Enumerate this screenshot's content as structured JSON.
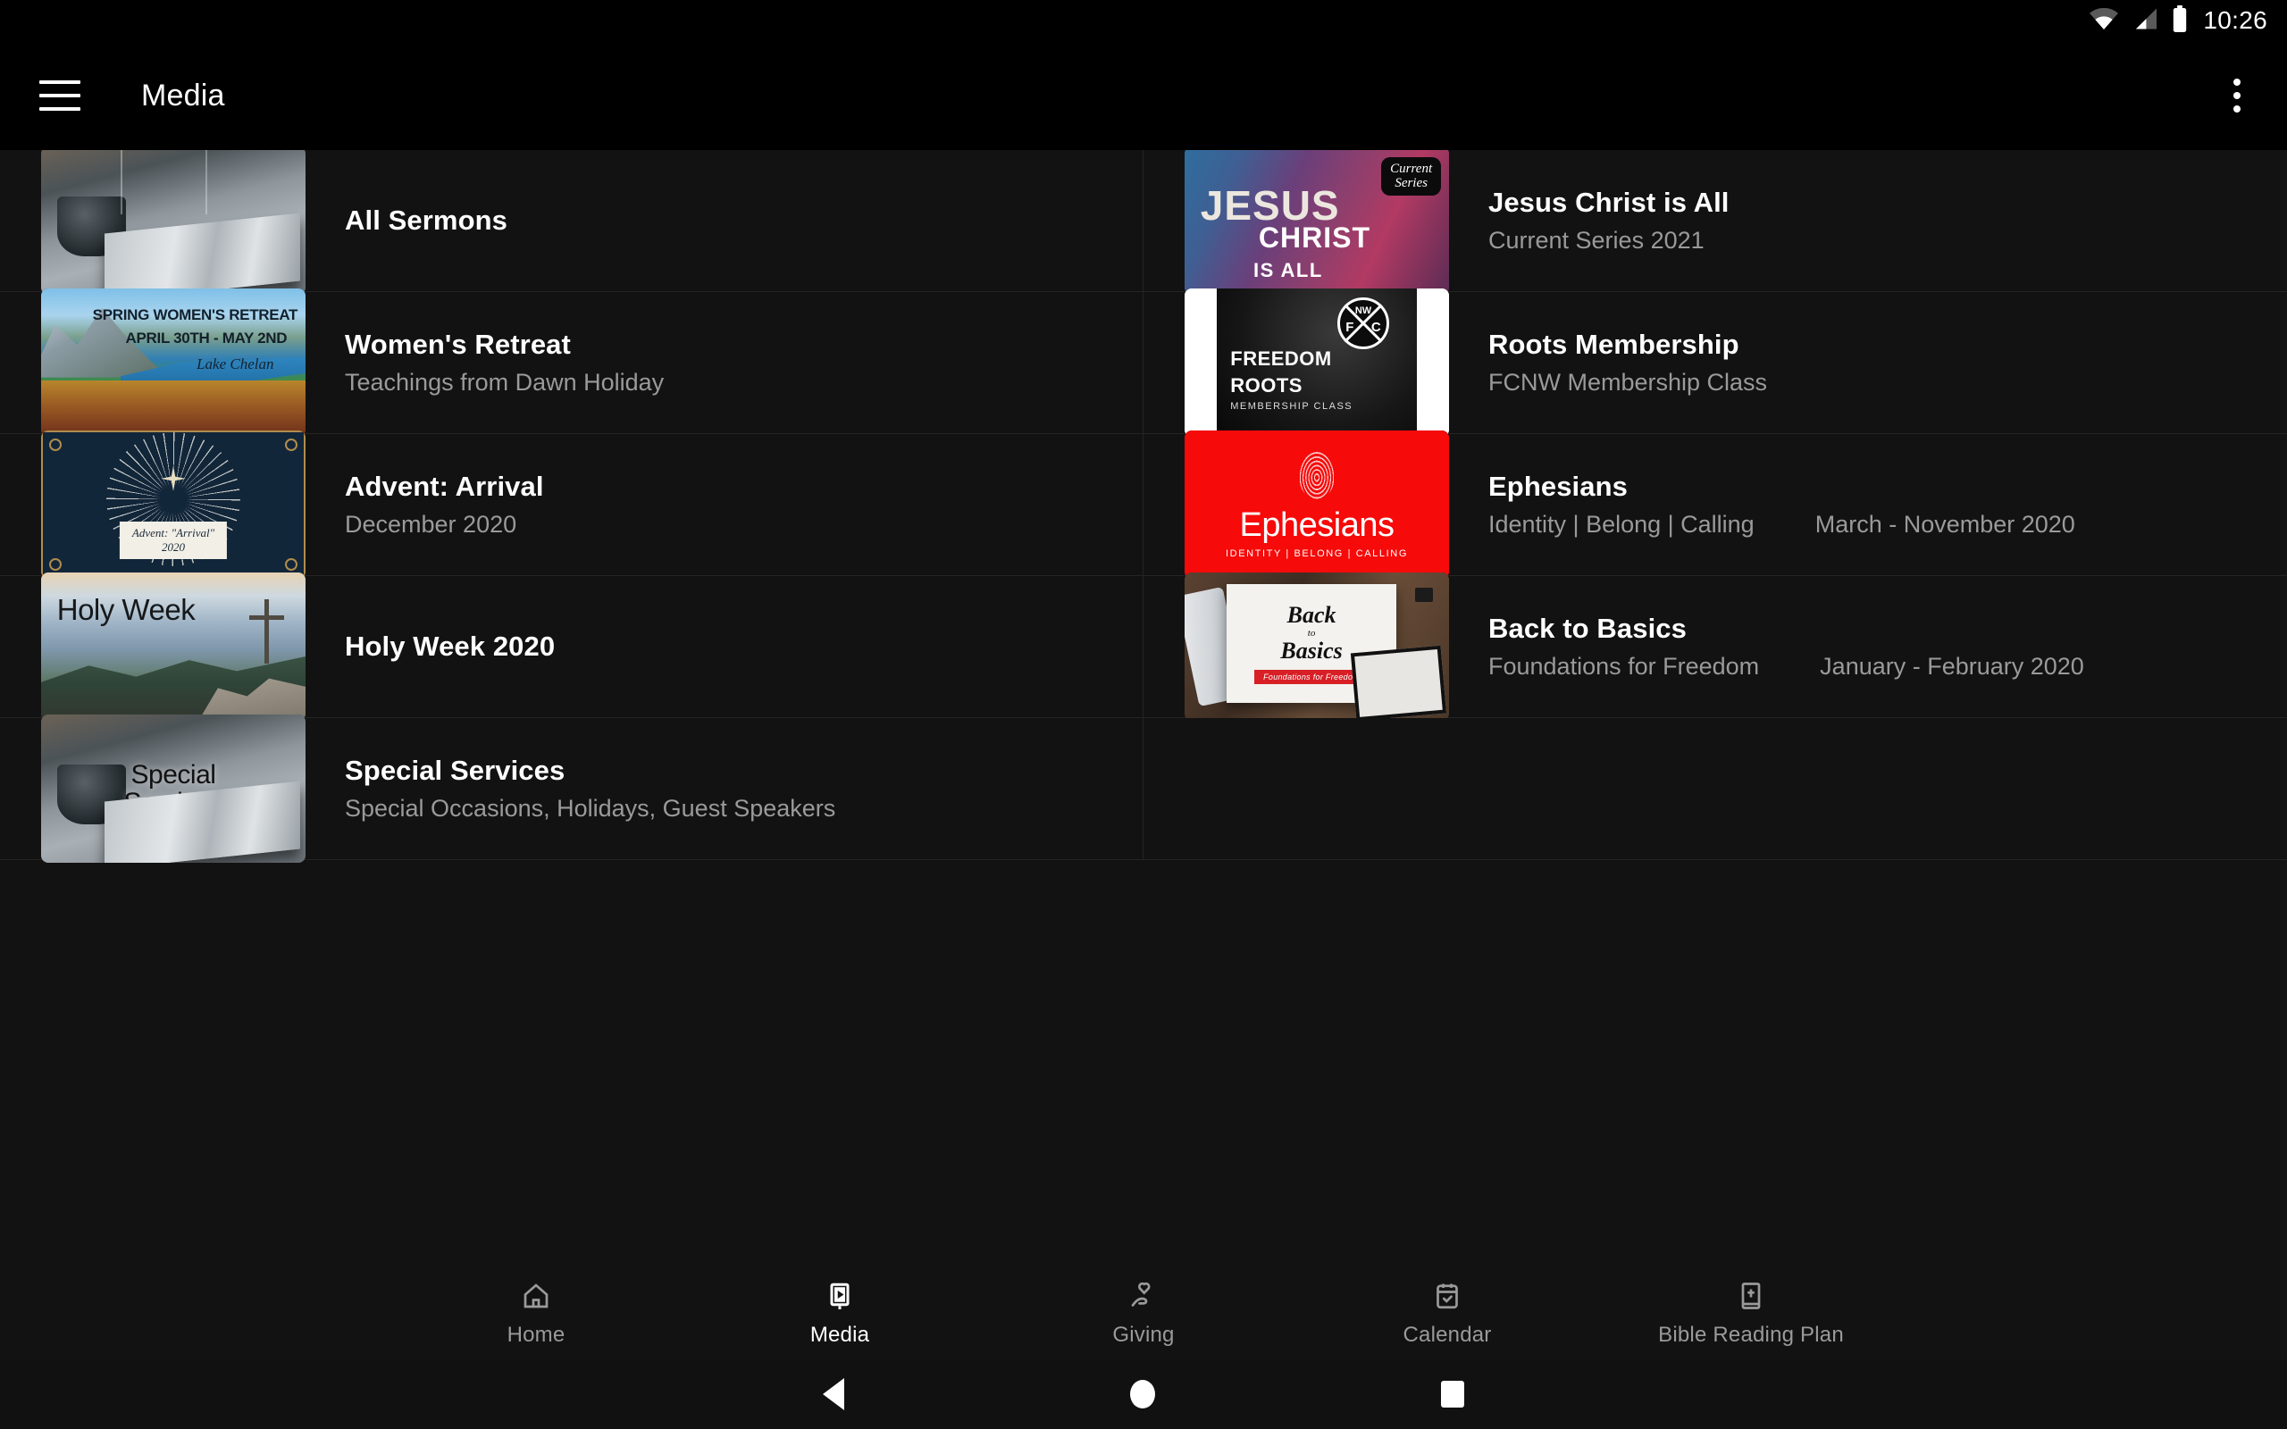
{
  "status_bar": {
    "time": "10:26",
    "icons": [
      "wifi-icon",
      "cellular-signal-icon",
      "battery-icon"
    ]
  },
  "app_bar": {
    "menu_icon": "hamburger-menu-icon",
    "title": "Media",
    "overflow_icon": "more-vertical-icon"
  },
  "media_items": [
    {
      "title": "All Sermons",
      "subtitle": "",
      "date": "",
      "thumb_kind": "bible",
      "thumb_text": {}
    },
    {
      "title": "Jesus Christ is All",
      "subtitle": "Current Series 2021",
      "date": "",
      "thumb_kind": "jesus",
      "thumb_text": {
        "line1": "JESUS",
        "line2": "CHRIST",
        "line3": "IS ALL",
        "badge1": "Current",
        "badge2": "Series"
      }
    },
    {
      "title": "Women's Retreat",
      "subtitle": "Teachings from Dawn Holiday",
      "date": "",
      "thumb_kind": "retreat",
      "thumb_text": {
        "line1": "SPRING WOMEN'S RETREAT",
        "line2": "APRIL 30TH - MAY 2ND",
        "line3": "Lake Chelan"
      }
    },
    {
      "title": "Roots Membership",
      "subtitle": "FCNW Membership Class",
      "date": "",
      "thumb_kind": "roots",
      "thumb_text": {
        "line1": "FREEDOM",
        "line2": "ROOTS",
        "line3": "MEMBERSHIP CLASS",
        "logo_nw": "NW",
        "logo_f": "F",
        "logo_c": "C"
      }
    },
    {
      "title": "Advent: Arrival",
      "subtitle": "December 2020",
      "date": "",
      "thumb_kind": "advent",
      "thumb_text": {
        "line1": "Advent: \"Arrival\"",
        "line2": "2020"
      }
    },
    {
      "title": "Ephesians",
      "subtitle": "Identity | Belong | Calling",
      "date": "March - November 2020",
      "thumb_kind": "ephesians",
      "thumb_text": {
        "line1": "Ephesians",
        "line2": "IDENTITY | BELONG | CALLING"
      }
    },
    {
      "title": "Holy Week 2020",
      "subtitle": "",
      "date": "",
      "thumb_kind": "holyweek",
      "thumb_text": {
        "line1": "Holy Week"
      }
    },
    {
      "title": "Back to Basics",
      "subtitle": "Foundations for Freedom",
      "date": "January - February 2020",
      "thumb_kind": "backtobasics",
      "thumb_text": {
        "line1": "Back",
        "line2": "to",
        "line3": "Basics",
        "line4": "Foundations for Freedom"
      }
    },
    {
      "title": "Special Services",
      "subtitle": "Special Occasions, Holidays, Guest Speakers",
      "date": "",
      "thumb_kind": "special",
      "thumb_text": {
        "line1": "Special",
        "line2": "Services"
      }
    }
  ],
  "bottom_nav": {
    "items": [
      {
        "label": "Home",
        "icon": "home-icon",
        "active": false
      },
      {
        "label": "Media",
        "icon": "media-play-icon",
        "active": true
      },
      {
        "label": "Giving",
        "icon": "hand-heart-icon",
        "active": false
      },
      {
        "label": "Calendar",
        "icon": "calendar-check-icon",
        "active": false
      },
      {
        "label": "Bible Reading Plan",
        "icon": "bible-book-icon",
        "active": false
      }
    ]
  },
  "system_nav": {
    "back": "back-triangle-icon",
    "home": "home-circle-icon",
    "recents": "recents-square-icon"
  },
  "colors": {
    "background": "#000000",
    "surface": "#121212",
    "divider": "#242424",
    "primary_text": "#ffffff",
    "secondary_text": "#9a9a9a",
    "accent_red": "#f60a0a"
  }
}
